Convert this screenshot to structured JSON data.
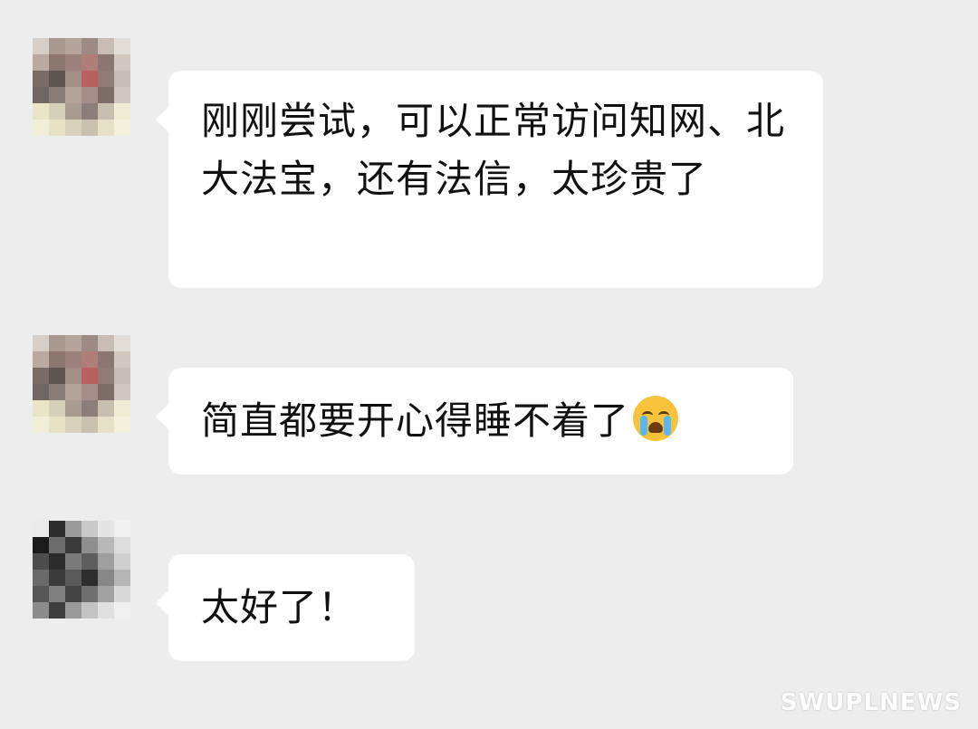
{
  "messages": [
    {
      "text": "刚刚尝试，可以正常访问知网、北大法宝，还有法信，太珍贵了",
      "avatar_icon": "pixelated-avatar-icon"
    },
    {
      "text": "简直都要开心得睡不着了",
      "emoji_icon": "loudly-crying-face-icon",
      "avatar_icon": "pixelated-avatar-icon"
    },
    {
      "text": "太好了！",
      "avatar_icon": "pixelated-avatar-icon"
    }
  ],
  "watermark": "SWUPLNEWS",
  "colors": {
    "background": "#ededed",
    "bubble": "#ffffff",
    "text": "#111111"
  }
}
